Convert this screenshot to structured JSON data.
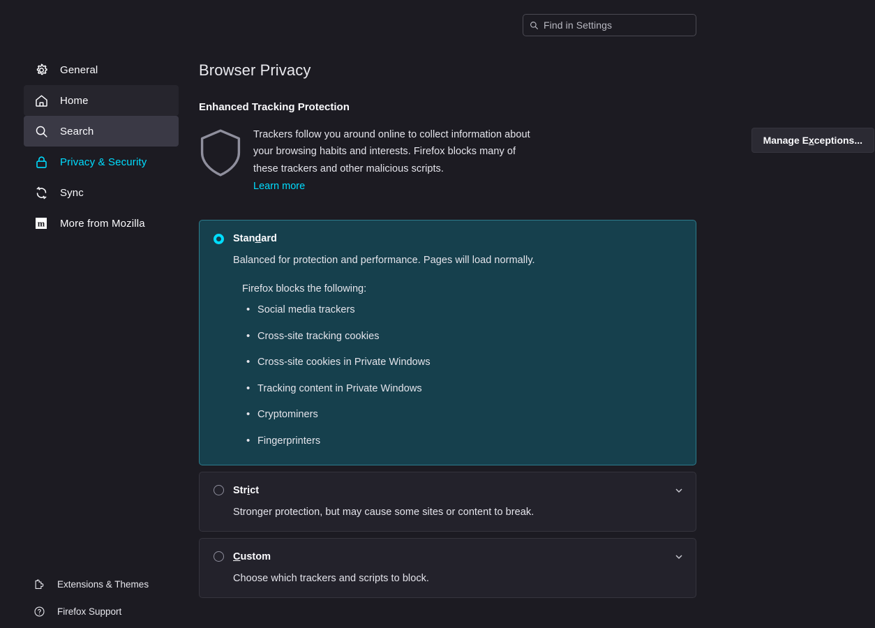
{
  "search": {
    "placeholder": "Find in Settings",
    "icon": "search-icon"
  },
  "sidebar": {
    "items": [
      {
        "label": "General",
        "icon": "gear-icon",
        "state": "normal"
      },
      {
        "label": "Home",
        "icon": "home-icon",
        "state": "soft"
      },
      {
        "label": "Search",
        "icon": "search-icon",
        "state": "strong"
      },
      {
        "label": "Privacy & Security",
        "icon": "lock-icon",
        "state": "current"
      },
      {
        "label": "Sync",
        "icon": "sync-icon",
        "state": "normal"
      },
      {
        "label": "More from Mozilla",
        "icon": "mozilla-m-icon",
        "state": "normal"
      }
    ],
    "bottom_links": [
      {
        "label": "Extensions & Themes",
        "icon": "puzzle-piece-icon"
      },
      {
        "label": "Firefox Support",
        "icon": "question-circle-icon"
      }
    ]
  },
  "main": {
    "page_title": "Browser Privacy",
    "section_title": "Enhanced Tracking Protection",
    "etp": {
      "shield_icon": "shield-icon",
      "description": "Trackers follow you around online to collect information about your browsing habits and interests. Firefox blocks many of these trackers and other malicious scripts.",
      "learn_more": "Learn more",
      "manage_exceptions_button": {
        "prefix": "Manage E",
        "accesskey": "x",
        "suffix": "ceptions..."
      }
    },
    "options": {
      "standard": {
        "label_prefix": "Stan",
        "label_accesskey": "d",
        "label_suffix": "ard",
        "selected": true,
        "description": "Balanced for protection and performance. Pages will load normally.",
        "blocks_heading": "Firefox blocks the following:",
        "blocked_items": [
          "Social media trackers",
          "Cross-site tracking cookies",
          "Cross-site cookies in Private Windows",
          "Tracking content in Private Windows",
          "Cryptominers",
          "Fingerprinters"
        ]
      },
      "strict": {
        "label_prefix": "Str",
        "label_accesskey": "i",
        "label_suffix": "ct",
        "selected": false,
        "description": "Stronger protection, but may cause some sites or content to break.",
        "expander_icon": "chevron-down-icon"
      },
      "custom": {
        "label_prefix": "",
        "label_accesskey": "C",
        "label_suffix": "ustom",
        "selected": false,
        "description": "Choose which trackers and scripts to block.",
        "expander_icon": "chevron-down-icon"
      }
    }
  },
  "colors": {
    "background": "#1c1b22",
    "accent_cyan": "#00ddff",
    "selected_panel_bg": "#16404d",
    "selected_panel_border": "#2d7c8c",
    "panel_bg": "#23222b",
    "button_bg": "#2b2a33",
    "text": "#fbfbfe"
  }
}
